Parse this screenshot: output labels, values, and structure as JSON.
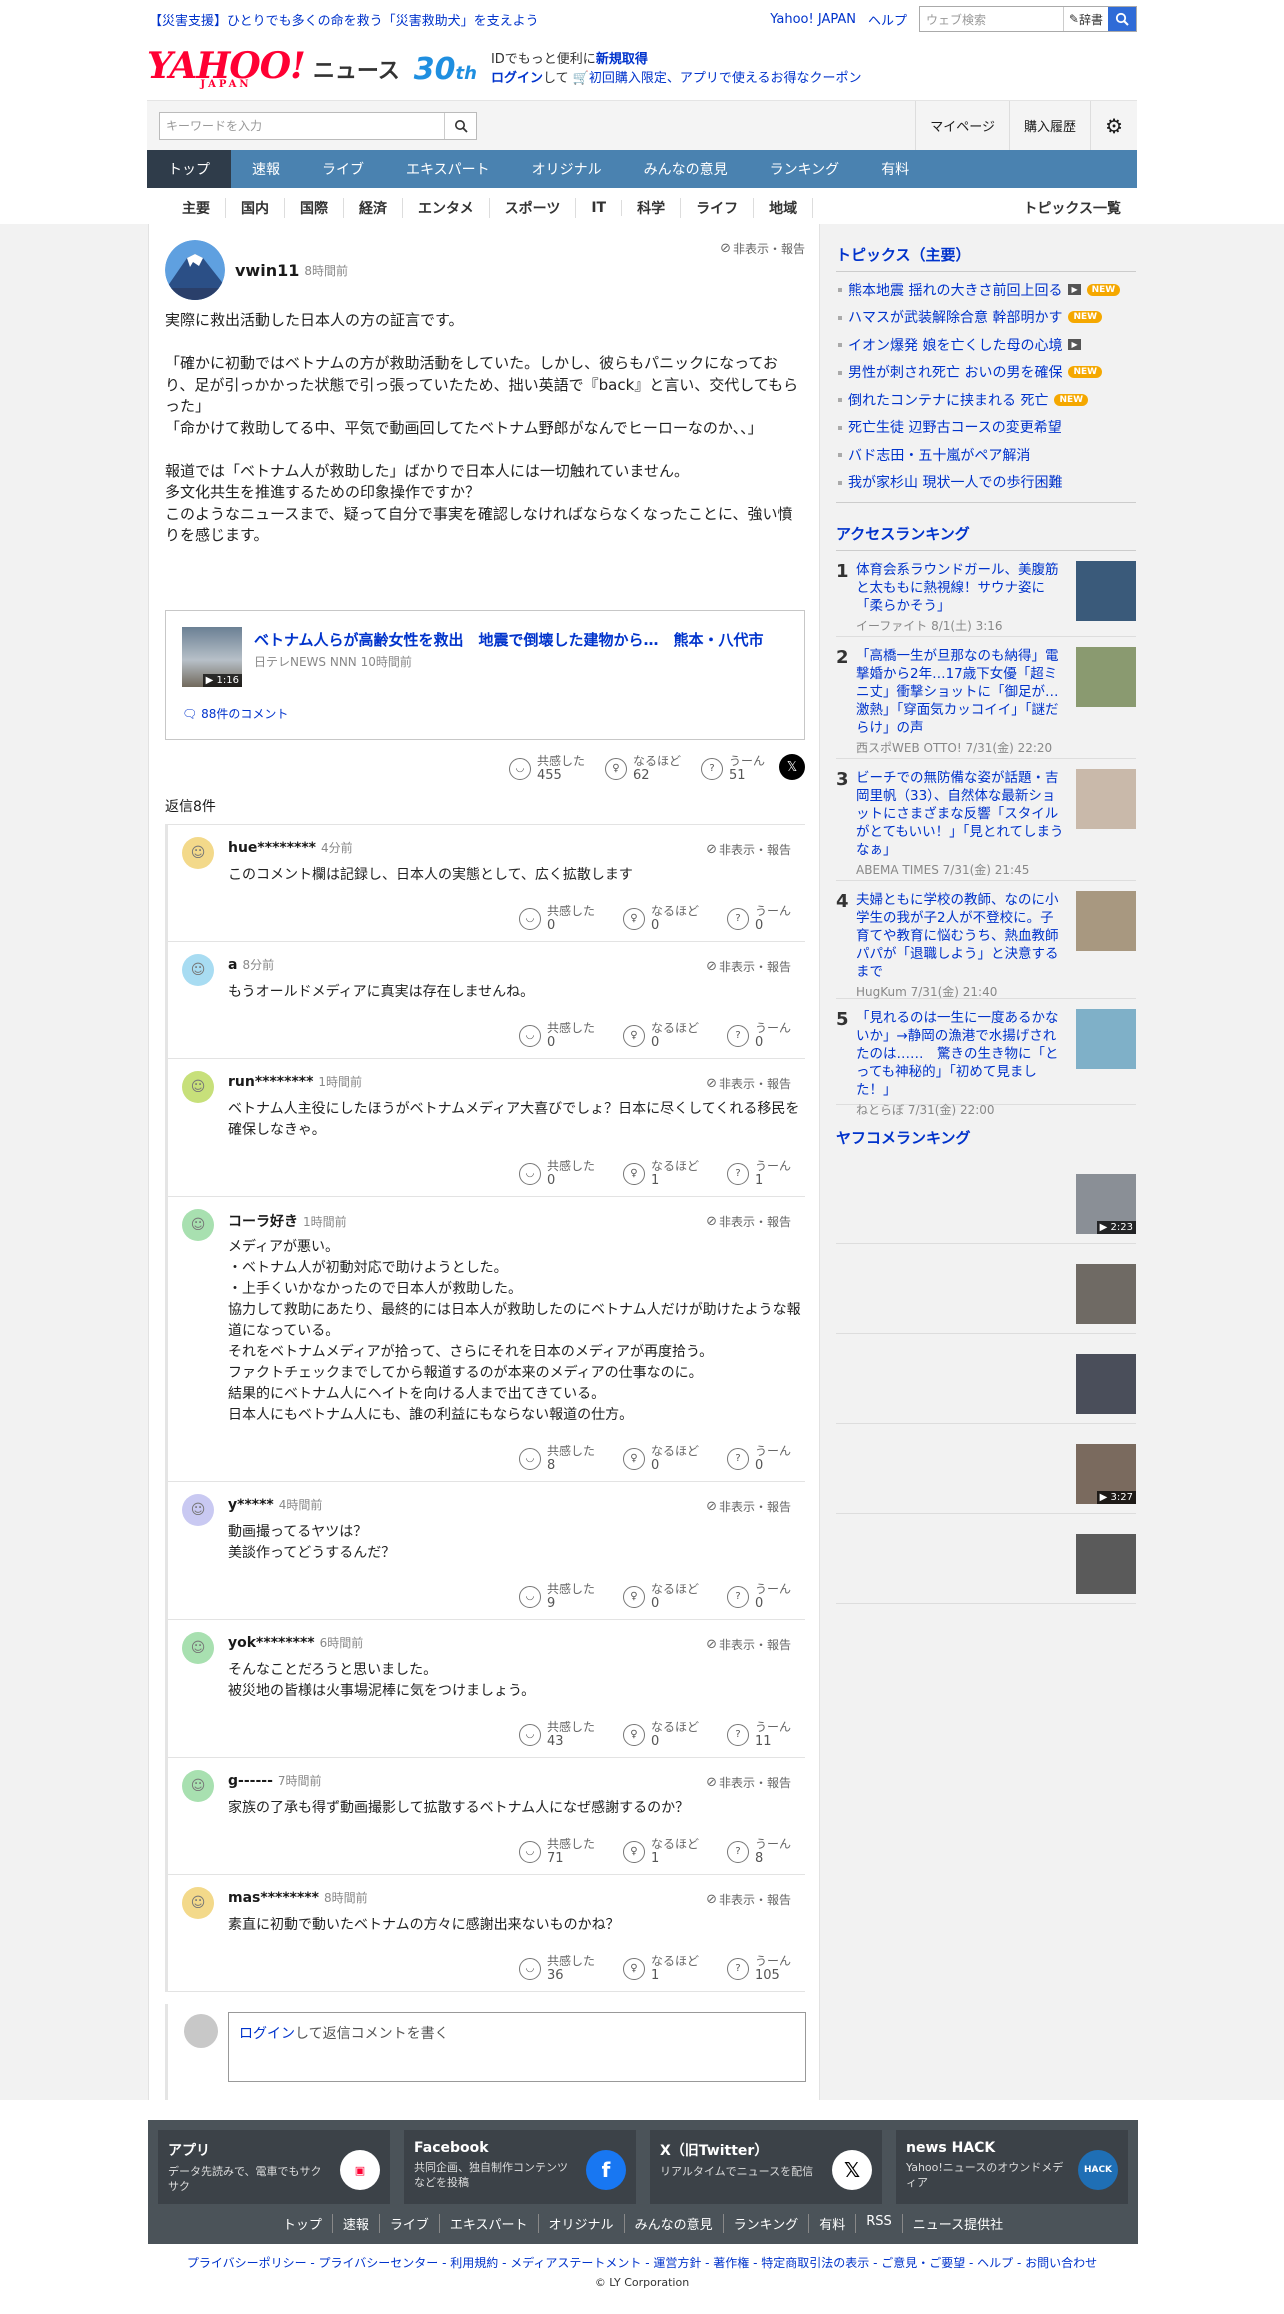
{
  "header": {
    "notice": "【災害支援】ひとりでも多くの命を救う「災害救助犬」を支えよう",
    "yahoo_japan": "Yahoo! JAPAN",
    "help": "ヘルプ",
    "web_search_placeholder": "ウェブ検索",
    "dict_label": "辞書",
    "logo_text": "YAHOO!",
    "logo_sub": "JAPAN",
    "news_label": "ニュース",
    "anniv": "30",
    "anniv_suffix": "th",
    "promo_line1_a": "IDでもっと便利に",
    "promo_line1_b": "新規取得",
    "promo_login": "ログイン",
    "promo_line2": "して",
    "promo_coupon": "初回購入限定、アプリで使えるお得なクーポン"
  },
  "search": {
    "placeholder": "キーワードを入力",
    "mypage": "マイページ",
    "history": "購入履歴"
  },
  "nav": [
    "トップ",
    "速報",
    "ライブ",
    "エキスパート",
    "オリジナル",
    "みんなの意見",
    "ランキング",
    "有料"
  ],
  "categories": [
    "主要",
    "国内",
    "国際",
    "経済",
    "エンタメ",
    "スポーツ",
    "IT",
    "科学",
    "ライフ",
    "地域"
  ],
  "topics_all": "トピックス一覧",
  "comment": {
    "user": "vwin11",
    "time": "8時間前",
    "hide": "非表示・報告",
    "body": "実際に救出活動した日本人の方の証言です。\n\n「確かに初動ではベトナムの方が救助活動をしていた。しかし、彼らもパニックになっており、足が引っかかった状態で引っ張っていたため、拙い英語で『back』と言い、交代してもらった」\n「命かけて救助してる中、平気で動画回してたベトナム野郎がなんでヒーローなのか、、」\n\n報道では「ベトナム人が救助した」ばかりで日本人には一切触れていません。\n多文化共生を推進するための印象操作ですか？\nこのようなニュースまで、疑って自分で事実を確認しなければならなくなったことに、強い憤りを感じます。",
    "article_title": "ベトナム人らが高齢女性を救出　地震で倒壊した建物から…　熊本・八代市",
    "article_src": "日テレNEWS NNN 10時間前",
    "article_dur": "1:16",
    "comments_link": "88件のコメント",
    "empathy": "455",
    "naruhodo": "62",
    "uun": "51"
  },
  "labels": {
    "empathy": "共感した",
    "naruhodo": "なるほど",
    "uun": "うーん",
    "replies_count": "返信8件",
    "hide": "非表示・報告"
  },
  "replies": [
    {
      "user": "hue********",
      "time": "4分前",
      "body": "このコメント欄は記録し、日本人の実態として、広く拡散します",
      "e": "0",
      "n": "0",
      "u": "0",
      "color": "#f3d98a"
    },
    {
      "user": "a",
      "time": "8分前",
      "body": "もうオールドメディアに真実は存在しませんね。",
      "e": "0",
      "n": "0",
      "u": "0",
      "color": "#a8dcf2"
    },
    {
      "user": "run********",
      "time": "1時間前",
      "body": "ベトナム人主役にしたほうがベトナムメディア大喜びでしょ？日本に尽くしてくれる移民を確保しなきゃ。",
      "e": "0",
      "n": "1",
      "u": "1",
      "color": "#c7e07a"
    },
    {
      "user": "コーラ好き",
      "time": "1時間前",
      "body": "メディアが悪い。\n・ベトナム人が初動対応で助けようとした。\n・上手くいかなかったので日本人が救助した。\n協力して救助にあたり、最終的には日本人が救助したのにベトナム人だけが助けたような報道になっている。\nそれをベトナムメディアが拾って、さらにそれを日本のメディアが再度拾う。\nファクトチェックまでしてから報道するのが本来のメディアの仕事なのに。\n結果的にベトナム人にヘイトを向ける人まで出てきている。\n日本人にもベトナム人にも、誰の利益にもならない報道の仕方。",
      "e": "8",
      "n": "0",
      "u": "0",
      "color": "#a8e0b0"
    },
    {
      "user": "y*****",
      "time": "4時間前",
      "body": "動画撮ってるヤツは？\n美談作ってどうするんだ？",
      "e": "9",
      "n": "0",
      "u": "0",
      "color": "#c9c9f2"
    },
    {
      "user": "yok********",
      "time": "6時間前",
      "body": "そんなことだろうと思いました。\n被災地の皆様は火事場泥棒に気をつけましょう。",
      "e": "43",
      "n": "0",
      "u": "11",
      "color": "#a8e0b0"
    },
    {
      "user": "g------",
      "time": "7時間前",
      "body": "家族の了承も得ず動画撮影して拡散するベトナム人になぜ感謝するのか？",
      "e": "71",
      "n": "1",
      "u": "8",
      "color": "#a8e0b0"
    },
    {
      "user": "mas********",
      "time": "8時間前",
      "body": "素直に初動で動いたベトナムの方々に感謝出来ないものかね？",
      "e": "36",
      "n": "1",
      "u": "105",
      "color": "#f3d98a"
    }
  ],
  "reply_box": {
    "login": "ログイン",
    "text": "して返信コメントを書く"
  },
  "sidebar": {
    "topics_title": "トピックス（主要）",
    "topics": [
      {
        "t": "熊本地震 揺れの大きさ前回上回る",
        "v": true,
        "n": true
      },
      {
        "t": "ハマスが武装解除合意 幹部明かす",
        "v": false,
        "n": true
      },
      {
        "t": "イオン爆発 娘を亡くした母の心境",
        "v": true,
        "n": false
      },
      {
        "t": "男性が刺され死亡 おいの男を確保",
        "v": false,
        "n": true
      },
      {
        "t": "倒れたコンテナに挟まれる 死亡",
        "v": false,
        "n": true
      },
      {
        "t": "死亡生徒 辺野古コースの変更希望",
        "v": false,
        "n": false
      },
      {
        "t": "バド志田・五十嵐がペア解消",
        "v": false,
        "n": false
      },
      {
        "t": "我が家杉山 現状一人での歩行困難",
        "v": false,
        "n": false
      }
    ],
    "access_title": "アクセスランキング",
    "access": [
      {
        "num": "1",
        "t": "体育会系ラウンドガール、美腹筋と太ももに熱視線！サウナ姿に「柔らかそう」",
        "s": "イーファイト 8/1(土) 3:16"
      },
      {
        "num": "2",
        "t": "「高橋一生が旦那なのも納得」電撃婚から2年…17歳下女優「超ミニ丈」衝撃ショットに「御足が…激熱」「穿面気カッコイイ」「謎だらけ」の声",
        "s": "西スポWEB OTTO! 7/31(金) 22:20"
      },
      {
        "num": "3",
        "t": "ビーチでの無防備な姿が話題・吉岡里帆（33）、自然体な最新ショットにさまざまな反響「スタイルがとてもいい！」「見とれてしまうなぁ」",
        "s": "ABEMA TIMES 7/31(金) 21:45"
      },
      {
        "num": "4",
        "t": "夫婦ともに学校の教師、なのに小学生の我が子2人が不登校に。子育てや教育に悩むうち、熱血教師パパが「退職しよう」と決意するまで",
        "s": "HugKum 7/31(金) 21:40"
      },
      {
        "num": "5",
        "t": "「見れるのは一生に一度あるかないか」→静岡の漁港で水揚げされたのは……　驚きの生き物に「とっても神秘的」「初めて見ました！」",
        "s": "ねとらぼ 7/31(金) 22:00"
      }
    ],
    "yafuco_title": "ヤフコメランキング",
    "yafuco": [
      {
        "dur": "2:23"
      },
      {
        "dur": ""
      },
      {
        "dur": ""
      },
      {
        "dur": "3:27"
      },
      {
        "dur": ""
      }
    ]
  },
  "footer": {
    "cards": [
      {
        "title": "アプリ",
        "desc": "データ先読みで、電車でもサクサク"
      },
      {
        "title": "Facebook",
        "desc": "共同企画、独自制作コンテンツなどを投稿"
      },
      {
        "title": "X（旧Twitter）",
        "desc": "リアルタイムでニュースを配信"
      },
      {
        "title": "news HACK",
        "desc": "Yahoo!ニュースのオウンドメディア"
      }
    ],
    "links": [
      "トップ",
      "速報",
      "ライブ",
      "エキスパート",
      "オリジナル",
      "みんなの意見",
      "ランキング",
      "有料",
      "RSS",
      "ニュース提供社"
    ],
    "legal": "プライバシーポリシー - プライバシーセンター - 利用規約 - メディアステートメント - 運営方針 - 著作権 - 特定商取引法の表示 - ご意見・ご要望 - ヘルプ - お問い合わせ",
    "copyright": "© LY Corporation"
  }
}
